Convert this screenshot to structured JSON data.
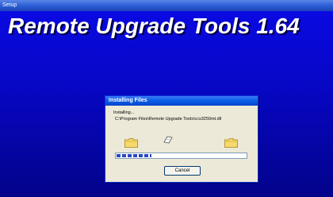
{
  "window": {
    "title": "Setup"
  },
  "banner": {
    "title": "Remote Upgrade Tools 1.64"
  },
  "dialog": {
    "title": "Installing Files",
    "status": "Installing...",
    "path": "C:\\Program Files\\Remote Upgrade Tools\\ccs3250mt.dll",
    "cancel_label": "Cancel",
    "progress": 0.27
  },
  "icons": {
    "source_folder": "folder-icon",
    "flying_file": "paper-icon",
    "target_folder": "folder-icon"
  },
  "colors": {
    "background": "#0707c4",
    "titlebar": "#0a5ee9",
    "dialog": "#ece9d8",
    "progress": "#2a47c8"
  }
}
